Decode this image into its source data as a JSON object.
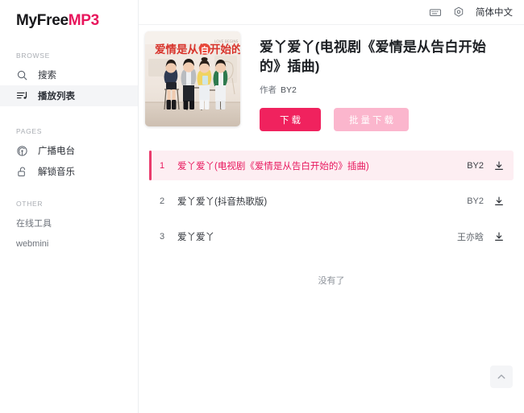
{
  "app": {
    "logo_primary": "MyFree",
    "logo_accent": "MP3",
    "accent_color": "#e8175d",
    "button_color": "#f0225e",
    "button_secondary_color": "#fbb6cd",
    "active_row_bg": "#fdeef2"
  },
  "sidebar": {
    "sections": [
      {
        "label": "BROWSE"
      },
      {
        "label": "PAGES"
      },
      {
        "label": "OTHER"
      }
    ],
    "browse": [
      {
        "label": "搜索",
        "icon": "search-icon",
        "active": false
      },
      {
        "label": "播放列表",
        "icon": "playlist-icon",
        "active": true
      }
    ],
    "pages": [
      {
        "label": "广播电台",
        "icon": "radio-icon",
        "active": false
      },
      {
        "label": "解锁音乐",
        "icon": "unlock-icon",
        "active": false
      }
    ],
    "other": [
      {
        "label": "在线工具"
      },
      {
        "label": "webmini"
      }
    ]
  },
  "topbar": {
    "keyboard_icon": "keyboard-icon",
    "settings_icon": "gear-icon",
    "language_label": "简体中文"
  },
  "album": {
    "cover_alt": "album-cover-art",
    "title": "爱丫爱丫(电视剧《爱情是从告白开始的》插曲)",
    "artist_key": "作者",
    "artist_value": "BY2",
    "download_label": "下载",
    "batch_download_label": "批量下载"
  },
  "tracks": [
    {
      "index": "1",
      "title": "爱丫爱丫(电视剧《爱情是从告白开始的》插曲)",
      "artist": "BY2",
      "active": true
    },
    {
      "index": "2",
      "title": "爱丫爱丫(抖音热歌版)",
      "artist": "BY2",
      "active": false
    },
    {
      "index": "3",
      "title": "爱丫爱丫",
      "artist": "王亦晗",
      "active": false
    }
  ],
  "list": {
    "end_text": "没有了"
  },
  "scroll_top": {
    "icon": "chevron-up-icon"
  }
}
